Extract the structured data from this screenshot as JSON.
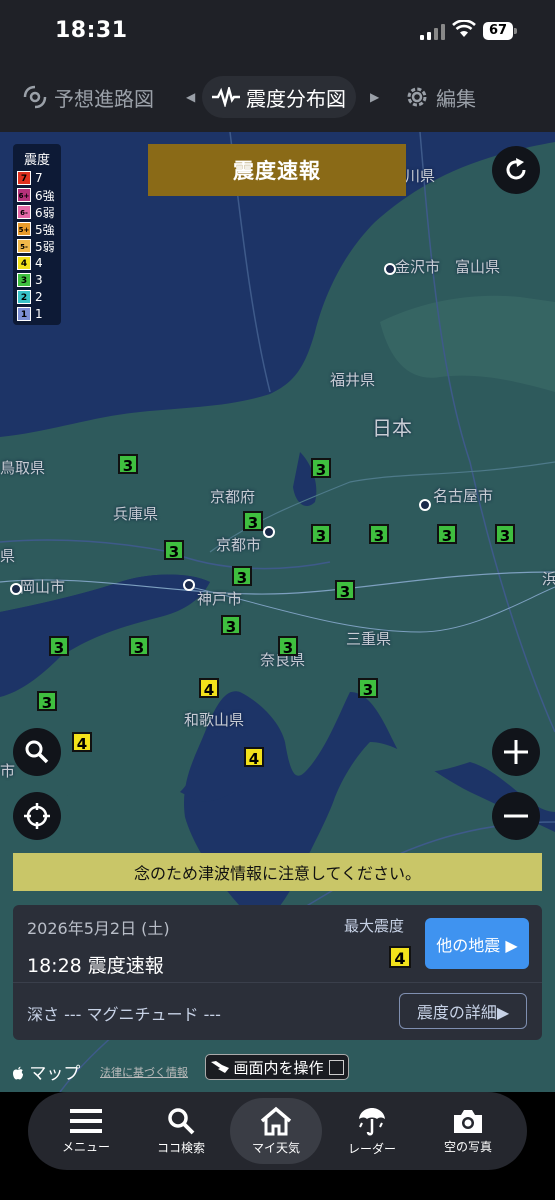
{
  "status": {
    "time": "18:31",
    "battery": "67"
  },
  "tabs": {
    "left": "予想進路図",
    "active": "震度分布図",
    "right": "編集"
  },
  "legend": {
    "title": "震度",
    "items": [
      {
        "badge": "7",
        "label": "7",
        "color": "#e0301e"
      },
      {
        "badge": "6+",
        "label": "6強",
        "color": "#b5317a"
      },
      {
        "badge": "6-",
        "label": "6弱",
        "color": "#e668a8"
      },
      {
        "badge": "5+",
        "label": "5強",
        "color": "#e89b2c"
      },
      {
        "badge": "5-",
        "label": "5弱",
        "color": "#f0b84a"
      },
      {
        "badge": "4",
        "label": "4",
        "color": "#f2e21b"
      },
      {
        "badge": "3",
        "label": "3",
        "color": "#3fbf3f"
      },
      {
        "badge": "2",
        "label": "2",
        "color": "#38c2c8"
      },
      {
        "badge": "1",
        "label": "1",
        "color": "#7d8fd6"
      }
    ]
  },
  "banner": "震度速報",
  "places": {
    "ishikawa": "石川県",
    "kanazawa": "金沢市",
    "toyama": "富山県",
    "fukui": "福井県",
    "nihon": "日本",
    "tottori": "鳥取県",
    "kyotofu": "京都府",
    "nagoya": "名古屋市",
    "hyogo": "兵庫県",
    "kyotoshi": "京都市",
    "okayama": "岡山市",
    "kobe": "神戸市",
    "mie": "三重県",
    "nara": "奈良県",
    "wakayama": "和歌山県",
    "ken": "県",
    "shi": "市",
    "hama": "浜"
  },
  "markers": [
    "3",
    "3",
    "3",
    "3",
    "3",
    "3",
    "3",
    "3",
    "3",
    "3",
    "3",
    "3",
    "3",
    "3",
    "4",
    "3",
    "3",
    "4",
    "4",
    "3",
    "4"
  ],
  "notice": "念のため津波情報に注意してください。",
  "quake": {
    "date": "2026年5月2日 (土)",
    "time_kind": "18:28 震度速報",
    "max_label": "最大震度",
    "max_value": "4",
    "other_button": "他の地震 ▶",
    "depth_text": "深さ --- マグニチュード ---",
    "detail_button": "震度の詳細▶"
  },
  "footer": {
    "maps": "マップ",
    "law": "法律に基づく情報",
    "operate": "画面内を操作"
  },
  "bottom_nav": [
    "メニュー",
    "ココ検索",
    "マイ天気",
    "レーダー",
    "空の写真"
  ]
}
